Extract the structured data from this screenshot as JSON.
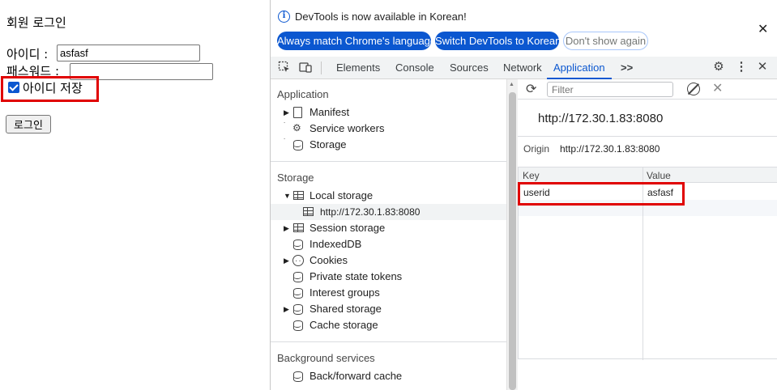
{
  "page": {
    "title": "회원 로그인",
    "id_label": "아이디 :",
    "id_value": "asfasf",
    "pw_label": "패스워드 :",
    "pw_value": "",
    "remember_label": "아이디 저장",
    "remember_checked": true,
    "login_button": "로그인"
  },
  "devtools": {
    "infobar": {
      "message": "DevTools is now available in Korean!",
      "btn_match": "Always match Chrome's language",
      "btn_switch": "Switch DevTools to Korean",
      "btn_dismiss": "Don't show again"
    },
    "tabs": [
      "Elements",
      "Console",
      "Sources",
      "Network",
      "Application"
    ],
    "active_tab": "Application",
    "more_tabs": ">>",
    "sidebar": {
      "application_title": "Application",
      "application_items": [
        "Manifest",
        "Service workers",
        "Storage"
      ],
      "storage_title": "Storage",
      "local_storage": "Local storage",
      "local_storage_origin": "http://172.30.1.83:8080",
      "storage_items": [
        "Session storage",
        "IndexedDB",
        "Cookies",
        "Private state tokens",
        "Interest groups",
        "Shared storage",
        "Cache storage"
      ],
      "background_title": "Background services",
      "background_items": [
        "Back/forward cache"
      ]
    },
    "pane": {
      "filter_placeholder": "Filter",
      "origin_title": "http://172.30.1.83:8080",
      "origin_label": "Origin",
      "origin_value": "http://172.30.1.83:8080",
      "col_key": "Key",
      "col_value": "Value",
      "rows": [
        {
          "key": "userid",
          "value": "asfasf"
        }
      ]
    }
  },
  "colors": {
    "accent": "#0b57d0",
    "highlight_box": "#e00000"
  }
}
